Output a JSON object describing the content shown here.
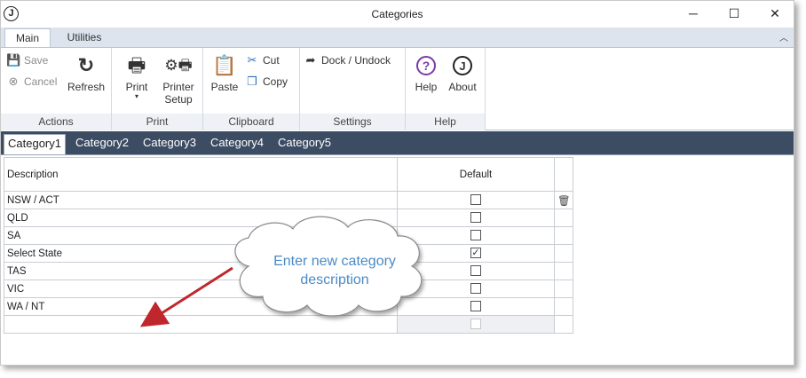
{
  "window": {
    "title": "Categories",
    "app_logo": "J",
    "minimize": "─",
    "maximize": "☐",
    "close": "✕"
  },
  "ribbon_tabs": [
    {
      "label": "Main"
    },
    {
      "label": "Utilities"
    }
  ],
  "ribbon": {
    "actions": {
      "save": "Save",
      "cancel": "Cancel",
      "refresh": "Refresh",
      "group": "Actions"
    },
    "print": {
      "print": "Print",
      "printer_setup_1": "Printer",
      "printer_setup_2": "Setup",
      "group": "Print"
    },
    "clipboard": {
      "paste": "Paste",
      "cut": "Cut",
      "copy": "Copy",
      "group": "Clipboard"
    },
    "settings": {
      "dock": "Dock / Undock",
      "group": "Settings"
    },
    "help": {
      "help": "Help",
      "about": "About",
      "group": "Help"
    }
  },
  "category_tabs": [
    "Category1",
    "Category2",
    "Category3",
    "Category4",
    "Category5"
  ],
  "grid": {
    "columns": {
      "description": "Description",
      "default": "Default"
    },
    "rows": [
      {
        "description": "NSW / ACT",
        "default": false
      },
      {
        "description": "QLD",
        "default": false
      },
      {
        "description": "SA",
        "default": false
      },
      {
        "description": "Select State",
        "default": true
      },
      {
        "description": "TAS",
        "default": false
      },
      {
        "description": "VIC",
        "default": false
      },
      {
        "description": "WA / NT",
        "default": false
      }
    ]
  },
  "callout": {
    "line1": "Enter new category",
    "line2": "description",
    "color": "#4a8ac6",
    "arrow_color": "#c0272d"
  }
}
